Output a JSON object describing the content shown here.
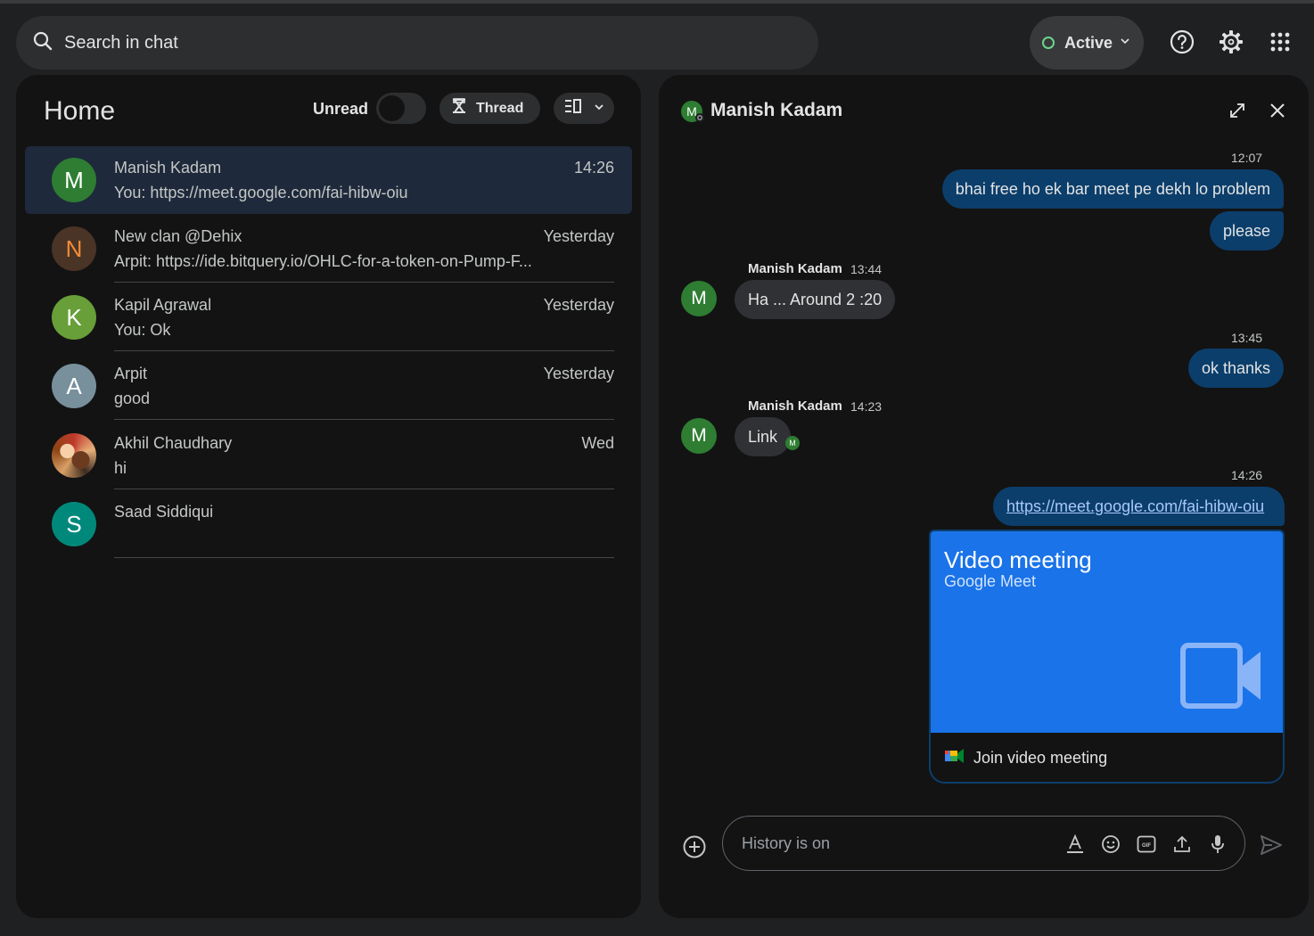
{
  "search": {
    "placeholder": "Search in chat"
  },
  "status": {
    "label": "Active",
    "color": "#6dd58c"
  },
  "topbar_icons": [
    "help-icon",
    "settings-icon",
    "apps-grid-icon"
  ],
  "home": {
    "title": "Home",
    "unread_label": "Unread",
    "unread_on": false,
    "thread_label": "Thread"
  },
  "conversations": [
    {
      "initial": "M",
      "name": "Manish Kadam",
      "preview": "You: https://meet.google.com/fai-hibw-oiu",
      "time": "14:26",
      "color": "#2e7d32"
    },
    {
      "initial": "N",
      "name": "New clan @Dehix",
      "preview": "Arpit: https://ide.bitquery.io/OHLC-for-a-token-on-Pump-F...",
      "time": "Yesterday",
      "color": "#4a3426"
    },
    {
      "initial": "K",
      "name": "Kapil Agrawal",
      "preview": "You: Ok",
      "time": "Yesterday",
      "color": "#689f38"
    },
    {
      "initial": "A",
      "name": "Arpit",
      "preview": "good",
      "time": "Yesterday",
      "color": "#78909c"
    },
    {
      "initial": "",
      "name": "Akhil Chaudhary",
      "preview": "hi",
      "time": "Wed",
      "color": "#a0522d"
    },
    {
      "initial": "S",
      "name": "Saad Siddiqui",
      "preview": "",
      "time": "",
      "color": "#00897b"
    }
  ],
  "chat": {
    "header_initial": "M",
    "title": "Manish Kadam",
    "messages": {
      "t1": "12:07",
      "out1": "bhai free ho ek bar meet pe dekh lo problem",
      "out2": "please",
      "in1_sender": "Manish Kadam",
      "in1_time": "13:44",
      "in1_text": "Ha ... Around 2 :20",
      "t2": "13:45",
      "out3": "ok thanks",
      "in2_sender": "Manish Kadam",
      "in2_time": "14:23",
      "in2_text": "Link",
      "in2_read_initial": "M",
      "t3": "14:26",
      "out_link": "https://meet.google.com/fai-hibw-oiu"
    },
    "meet_card": {
      "title": "Video meeting",
      "subtitle": "Google Meet",
      "join_label": "Join video meeting"
    },
    "compose": {
      "placeholder": "History is on"
    }
  },
  "accent_colors": {
    "outgoing_bubble": "#0b3e6b",
    "incoming_bubble": "#303134",
    "meet_blue": "#1a73e8",
    "selected_row": "#1e293b"
  }
}
